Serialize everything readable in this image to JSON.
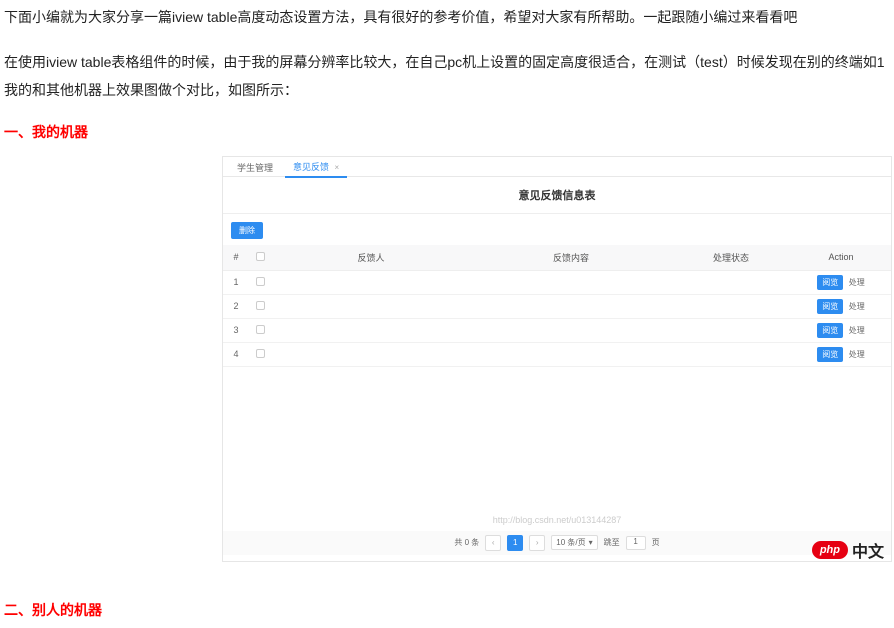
{
  "paragraphs": {
    "p1": "下面小编就为大家分享一篇iview table高度动态设置方法，具有很好的参考价值，希望对大家有所帮助。一起跟随小编过来看看吧",
    "p2": "在使用iview table表格组件的时候，由于我的屏幕分辨率比较大，在自己pc机上设置的固定高度很适合，在测试（test）时候发现在别的终端如1",
    "p3": "我的和其他机器上效果图做个对比，如图所示："
  },
  "headings": {
    "h1": "一、我的机器",
    "h2": "二、别人的机器"
  },
  "sshot": {
    "tabs": {
      "t1": "学生管理",
      "t2": "意见反馈"
    },
    "title": "意见反馈信息表",
    "toolbar": {
      "delete_btn": "删除"
    },
    "headers": {
      "idx": "#",
      "person": "反馈人",
      "content": "反馈内容",
      "status": "处理状态",
      "action": "Action"
    },
    "rows": [
      {
        "idx": "1"
      },
      {
        "idx": "2"
      },
      {
        "idx": "3"
      },
      {
        "idx": "4"
      }
    ],
    "action_btn": "阅览",
    "action_link": "处理",
    "watermark": "http://blog.csdn.net/u013144287",
    "pager": {
      "total": "共 0 条",
      "page": "1",
      "size": "10 条/页",
      "goto_label": "跳至",
      "goto_value": "1",
      "goto_suffix": "页"
    }
  },
  "brand": {
    "php": "php",
    "cn": "中文"
  }
}
